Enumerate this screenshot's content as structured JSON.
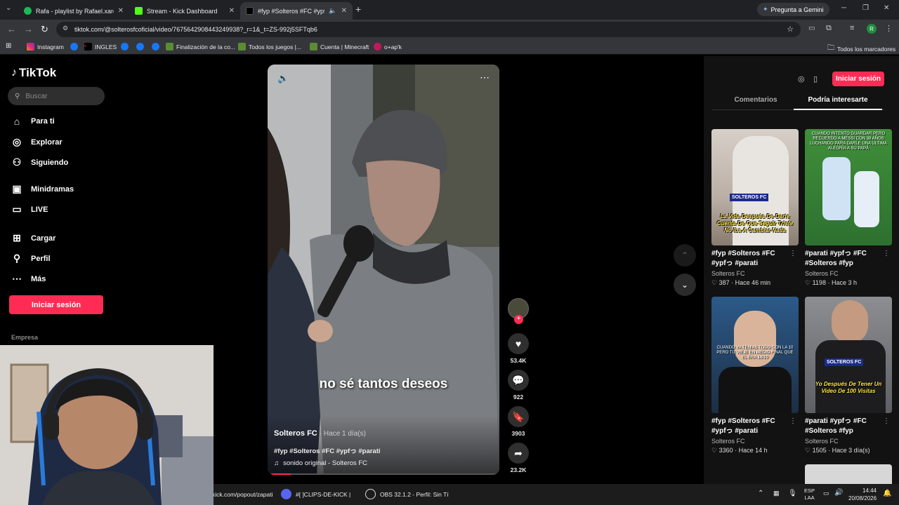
{
  "browser": {
    "tabs": [
      {
        "label": "Rafa - playlist by Rafael.xared |",
        "favicon": "spotify-icon"
      },
      {
        "label": "Stream - Kick Dashboard",
        "favicon": "kick-icon"
      },
      {
        "label": "#fyp #Solteros #FC #ypfっ #",
        "favicon": "tiktok-icon"
      }
    ],
    "gemini_label": "Pregunta a Gemini",
    "url": "tiktok.com/@solterosfcoficial/video/7675642908443249938?_r=1&_t=ZS-992j5SFTqb6",
    "profile_initial": "R",
    "bookmarks": [
      "Instagram",
      "INGLES",
      "Finalización de la co...",
      "Todos los juegos |...",
      "Cuenta | Minecraft",
      "o+ap'k"
    ],
    "all_bookmarks": "Todos los marcadores"
  },
  "tiktok": {
    "logo": "TikTok",
    "search_placeholder": "Buscar",
    "nav": [
      {
        "label": "Para ti",
        "icon": "home-icon"
      },
      {
        "label": "Explorar",
        "icon": "compass-icon"
      },
      {
        "label": "Siguiendo",
        "icon": "following-icon"
      },
      {
        "label": "Minidramas",
        "icon": "minidramas-icon"
      },
      {
        "label": "LIVE",
        "icon": "live-icon"
      },
      {
        "label": "Cargar",
        "icon": "upload-icon"
      },
      {
        "label": "Perfil",
        "icon": "profile-icon"
      },
      {
        "label": "Más",
        "icon": "more-icon"
      }
    ],
    "login_label": "Iniciar sesión",
    "company_label": "Empresa",
    "video": {
      "subtitle": "no sé tantos deseos",
      "author": "Solteros FC",
      "time": "· Hace 1 día(s)",
      "hashtags": "#fyp #Solteros #FC #ypfっ #parati",
      "sound": "sonido original - Solteros FC"
    },
    "actions": {
      "likes": "53.4K",
      "comments": "922",
      "saves": "3903",
      "shares": "23.2K"
    },
    "right": {
      "login_label": "Iniciar sesión",
      "tab_comments": "Comentarios",
      "tab_interest": "Podría interesarte",
      "cards": [
        {
          "title": "#fyp #Solteros #FC #ypfっ #parati",
          "author": "Solteros FC",
          "likes": "387",
          "time": "Hace 46 min",
          "overlay": "La Vida Después De Darte Cuenta De Que Seguir Triste No Iba A Cambiar Nada",
          "logo": "SOLTEROS FC"
        },
        {
          "title": "#parati #ypfっ #FC #Solteros #fyp",
          "author": "Solteros FC",
          "likes": "1198",
          "time": "Hace 3 h",
          "overlay": "CUANDO INTENTO GUARDAR PERO RECUERDO A MESSI CON 38 AÑOS LUCHANDO PARA DARLE UNA ULTIMA ALEGRÍA A SU PAPÁ",
          "logo": ""
        },
        {
          "title": "#fyp #Solteros #FC #ypfっ #parati",
          "author": "Solteros FC",
          "likes": "3360",
          "time": "Hace 14 h",
          "overlay": "CUANDO YA TENIAS TODO CON LA 10 PERO TU VIEJE EN MEDIO FINAL QUE EL ERA 18/10",
          "logo": ""
        },
        {
          "title": "#parati #ypfっ #FC #Solteros #fyp",
          "author": "Solteros FC",
          "likes": "1505",
          "time": "Hace 3 día(s)",
          "overlay": "Yo Después De Tener Un Video De 100 Visitas",
          "logo": "SOLTEROS FC"
        }
      ]
    }
  },
  "taskbar": {
    "items": [
      "kick.com/popout/zapati",
      "#[ ]CLIPS-DE-KICK |",
      "OBS 32.1.2 - Perfil: Sin Tí"
    ],
    "lang": "ESP",
    "lang2": "LAA",
    "time": "14:44",
    "date": "20/08/2026"
  }
}
